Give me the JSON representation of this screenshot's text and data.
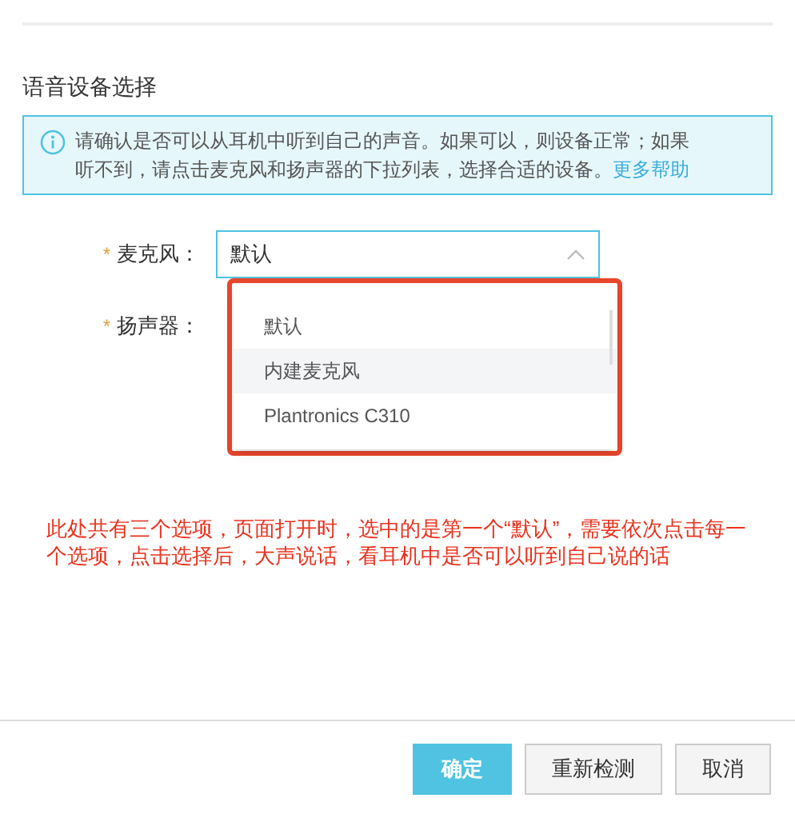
{
  "section_title": "语音设备选择",
  "info": {
    "text": "请确认是否可以从耳机中听到自己的声音。如果可以，则设备正常；如果听不到，请点击麦克风和扬声器的下拉列表，选择合适的设备。",
    "link": "更多帮助"
  },
  "fields": [
    {
      "required_mark": "*",
      "label": "麦克风：",
      "value": "默认",
      "expanded": true
    },
    {
      "required_mark": "*",
      "label": "扬声器："
    }
  ],
  "dropdown": {
    "options": [
      {
        "label": "默认",
        "highlighted": false
      },
      {
        "label": "内建麦克风",
        "highlighted": true
      },
      {
        "label": "Plantronics C310",
        "highlighted": false
      }
    ]
  },
  "annotation": "此处共有三个选项，页面打开时，选中的是第一个“默认”，需要依次点击每一个选项，点击选择后，大声说话，看耳机中是否可以听到自己说的话",
  "buttons": [
    {
      "label": "确定",
      "kind": "primary"
    },
    {
      "label": "重新检测",
      "kind": "default"
    },
    {
      "label": "取消",
      "kind": "default"
    }
  ]
}
